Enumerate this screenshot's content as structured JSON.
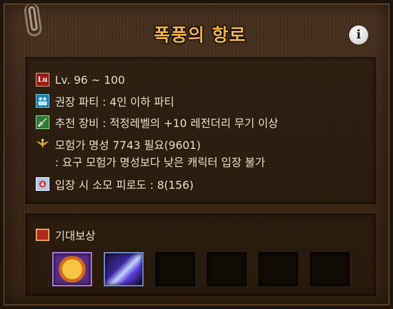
{
  "title": "폭풍의 항로",
  "info": {
    "icon": "info-icon",
    "glyph": "i"
  },
  "details": {
    "level": {
      "icon_text": "Lu",
      "text": "Lv. 96 ~ 100"
    },
    "party": {
      "text": "권장 파티 : 4인 이하 파티"
    },
    "equipment": {
      "text": "추천 장비 : 적정레벨의 +10 레전더리 무기 이상"
    },
    "fame": {
      "text": "모험가 명성 7743 필요(9601)",
      "note": ": 요구 모험가 명성보다 낮은 캐릭터 입장 불가"
    },
    "fatigue": {
      "text": "입장 시 소모 피로도 : 8(156)"
    }
  },
  "rewards": {
    "label": "기대보상",
    "slots": [
      {
        "item": "orb-item-icon"
      },
      {
        "item": "crystal-item-icon"
      },
      {
        "item": null
      },
      {
        "item": null
      },
      {
        "item": null
      },
      {
        "item": null
      }
    ]
  },
  "colors": {
    "title": "#f3b24a",
    "text": "#e8dcc6",
    "panel": "#3d2918"
  }
}
